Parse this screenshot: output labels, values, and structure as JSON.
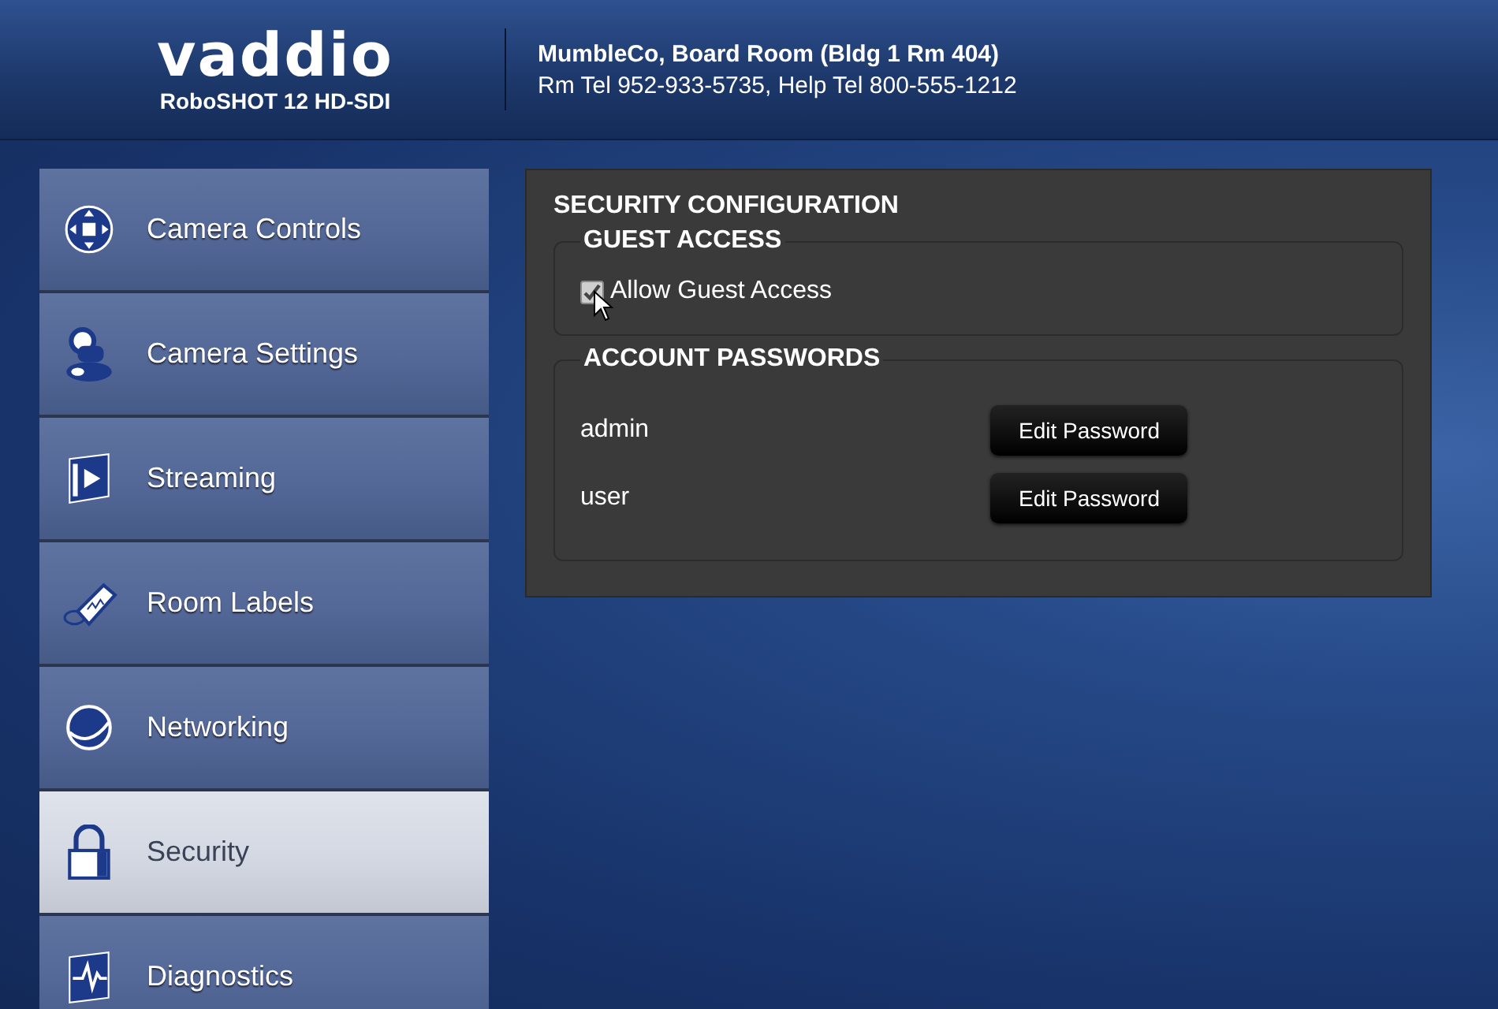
{
  "header": {
    "logo": "vaddio",
    "product": "RoboSHOT 12 HD-SDI",
    "location": "MumbleCo, Board Room (Bldg 1 Rm 404)",
    "phones": "Rm Tel 952-933-5735, Help Tel 800-555-1212"
  },
  "sidebar": {
    "items": [
      {
        "label": "Camera Controls",
        "selected": false
      },
      {
        "label": "Camera Settings",
        "selected": false
      },
      {
        "label": "Streaming",
        "selected": false
      },
      {
        "label": "Room Labels",
        "selected": false
      },
      {
        "label": "Networking",
        "selected": false
      },
      {
        "label": "Security",
        "selected": true
      },
      {
        "label": "Diagnostics",
        "selected": false
      }
    ]
  },
  "panel": {
    "title": "SECURITY CONFIGURATION",
    "guest_access": {
      "legend": "GUEST ACCESS",
      "checkbox": {
        "label": "Allow Guest Access",
        "checked": true
      }
    },
    "account_passwords": {
      "legend": "ACCOUNT PASSWORDS",
      "accounts": [
        {
          "name": "admin",
          "button": "Edit Password"
        },
        {
          "name": "user",
          "button": "Edit Password"
        }
      ]
    }
  }
}
